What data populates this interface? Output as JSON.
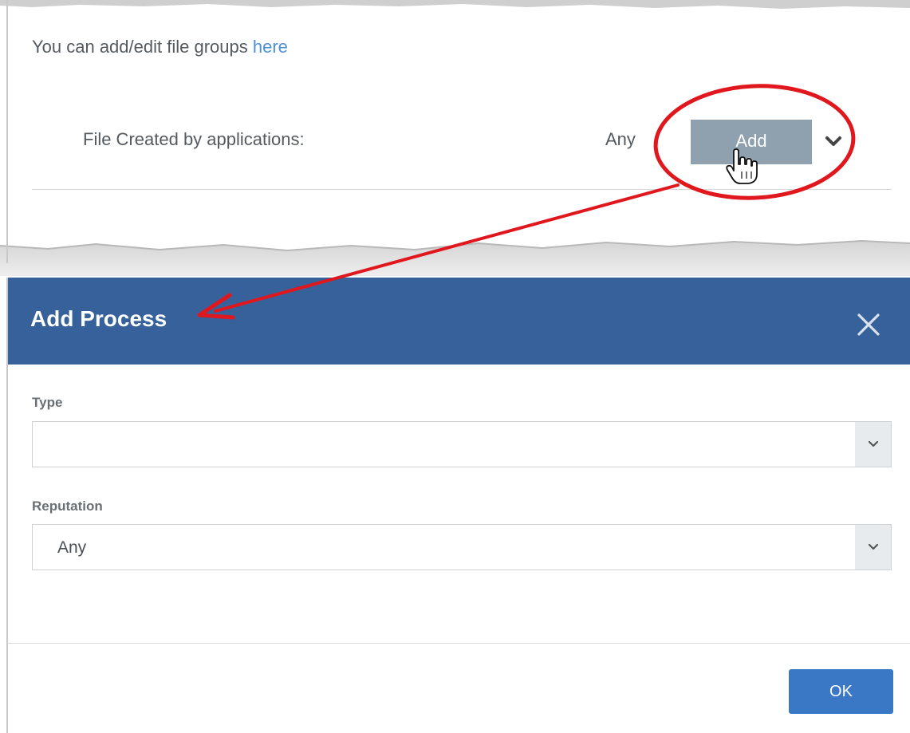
{
  "top": {
    "intro_text": "You can add/edit file groups ",
    "intro_link": "here",
    "row_label": "File Created by applications:",
    "any_value": "Any",
    "add_button": "Add"
  },
  "dialog": {
    "title": "Add Process",
    "fields": [
      {
        "label": "Type",
        "value": ""
      },
      {
        "label": "Reputation",
        "value": "Any"
      }
    ],
    "ok_button": "OK"
  },
  "colors": {
    "header_bg": "#36619a",
    "ok_bg": "#3a78c6",
    "add_bg": "#8fa0ae",
    "annotation": "#e0181e",
    "link": "#4f8fd6"
  },
  "icons": [
    "chevron-down-icon",
    "hand-cursor-icon",
    "close-icon",
    "select-arrow-icon"
  ]
}
